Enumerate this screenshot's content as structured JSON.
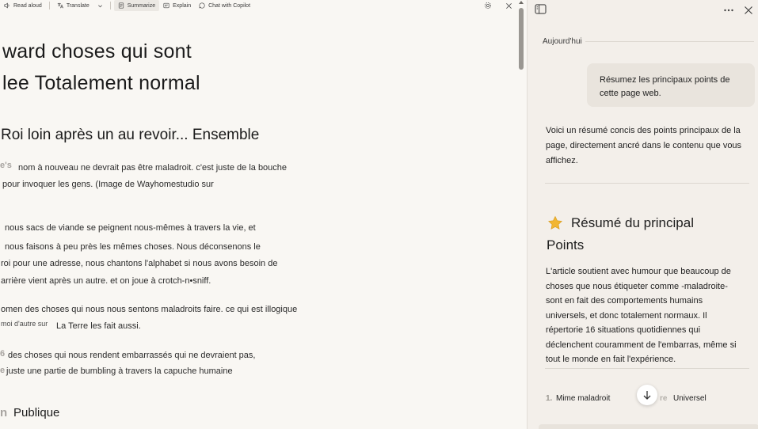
{
  "toolbar": {
    "read_aloud": "Read aloud",
    "translate": "Translate",
    "summarize": "Summarize",
    "explain": "Explain",
    "chat": "Chat with Copilot"
  },
  "article": {
    "heading1_line1": "ward choses qui sont",
    "heading1_line2": "lee Totalement normal",
    "heading2": "Roi loin après un au revoir... Ensemble",
    "para1_ghost": "e's",
    "para1_line1": "nom à nouveau ne devrait pas être maladroit. c'est juste de la bouche",
    "para1_line2": "pour invoquer les gens. (Image de Wayhomestudio sur",
    "para2_line1": "nous sacs de viande se peignent nous-mêmes à travers la vie, et",
    "para2_line2": "nous faisons à peu près les mêmes choses. Nous déconsenons le",
    "para2_line3": "roi pour une adresse, nous chantons l'alphabet si nous avons besoin de",
    "para2_line4": "arrière vient après un autre. et on joue à crotch-n•sniff.",
    "para3_line1": "omen des choses qui nous nous sentons maladroits faire. ce qui est illogique",
    "para3_line2a": "moi d'autre sur",
    "para3_line2b": "La Terre les fait aussi.",
    "para4_ghost1": "6",
    "para4_line1": "des choses qui nous rendent embarrassés qui ne devraient pas,",
    "para4_ghost2": "e",
    "para4_line2": "juste une partie de bumbling à travers la capuche humaine",
    "heading3_ghost": "n",
    "heading3": "Publique"
  },
  "panel": {
    "date_label": "Aujourd'hui",
    "user_message": "Résumez les principaux points de cette page web.",
    "answer_intro": "Voici un résumé concis des points principaux de la page, directement ancré dans le contenu que vous affichez.",
    "card_title_line1": "Résumé du principal",
    "card_title_line2": "Points",
    "card_body": "L'article soutient avec humour que beaucoup de choses que nous étiqueter comme -maladroite- sont en fait des comportements humains universels, et donc totalement normaux. Il répertorie 16 situations quotidiennes qui déclenchent couramment de l'embarras, même si tout le monde en fait l'expérience.",
    "list_number": "1.",
    "list_left": "Mime maladroit",
    "list_ghost": "re",
    "list_right": "Universel"
  },
  "icons": {
    "read_aloud": "read-aloud-icon",
    "translate": "translate-icon",
    "summarize": "summarize-icon",
    "explain": "explain-icon",
    "chat": "copilot-chat-icon",
    "settings": "gear-icon",
    "close_reader": "close-icon",
    "sidebar_toggle": "sidebar-toggle-icon",
    "more": "more-options-icon",
    "close_panel": "close-icon",
    "star": "star-icon",
    "scroll_down": "arrow-down-icon"
  },
  "colors": {
    "reader_bg": "#f9f7f3",
    "panel_bg": "#f3efea",
    "bubble_bg": "#e9e4dd",
    "star": "#f2b632"
  }
}
